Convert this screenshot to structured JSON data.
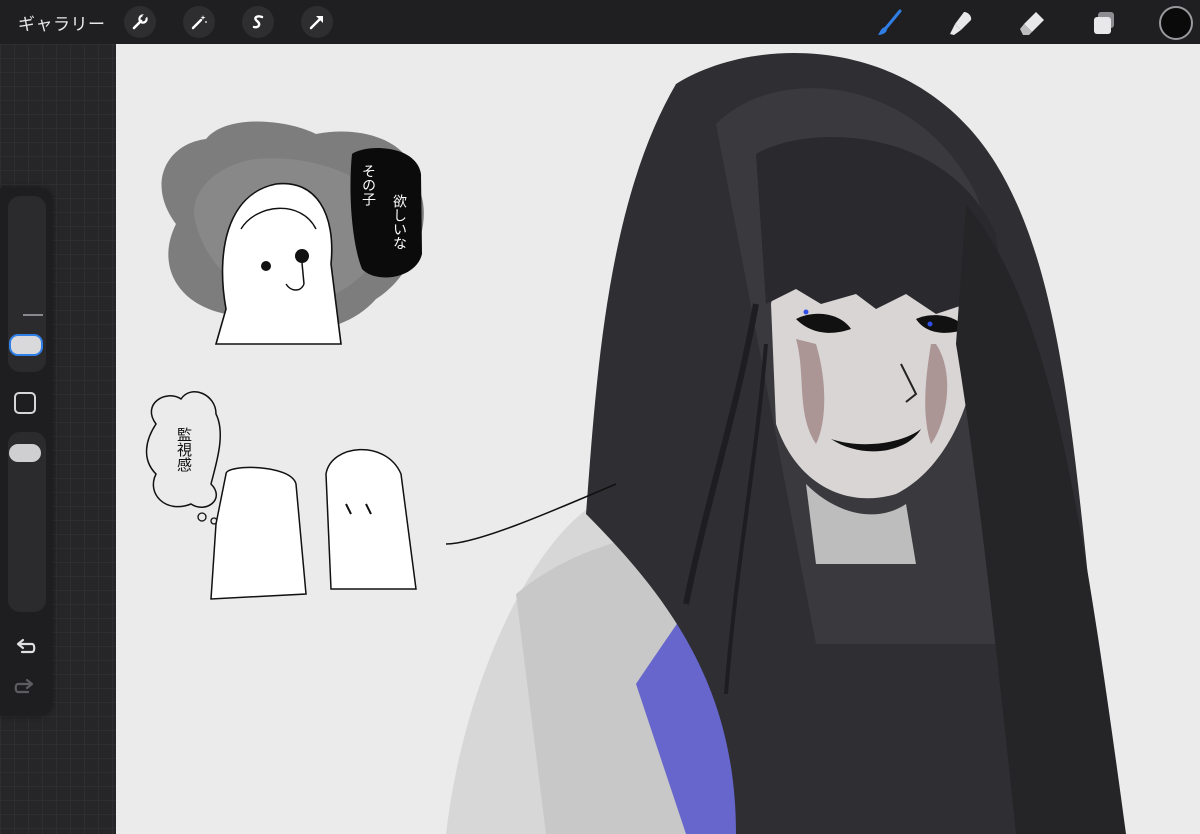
{
  "topbar": {
    "gallery_label": "ギャラリー",
    "left_tools": [
      {
        "name": "actions",
        "icon": "wrench-icon"
      },
      {
        "name": "adjustments",
        "icon": "magic-wand-icon"
      },
      {
        "name": "selection",
        "icon": "selection-s-icon"
      },
      {
        "name": "transform",
        "icon": "arrow-cursor-icon"
      }
    ],
    "right_tools": [
      {
        "name": "brush",
        "icon": "brush-icon",
        "active": true
      },
      {
        "name": "smudge",
        "icon": "smudge-icon",
        "active": false
      },
      {
        "name": "eraser",
        "icon": "eraser-icon",
        "active": false
      },
      {
        "name": "layers",
        "icon": "layers-icon",
        "active": false
      }
    ],
    "current_color": "#0a0a0a",
    "active_accent": "#2f7fe6"
  },
  "sidebar": {
    "brush_size_slider": {
      "level": 0.3
    },
    "opacity_slider": {
      "level": 1.0
    },
    "undo_icon": "undo-arrow-icon",
    "redo_icon": "redo-arrow-icon"
  },
  "canvas": {
    "background": "#ebebeb",
    "bubble_text_1": "その子",
    "bubble_text_2": "欲しいな",
    "thought_text": "監視感",
    "thought_suffix": "。。"
  }
}
